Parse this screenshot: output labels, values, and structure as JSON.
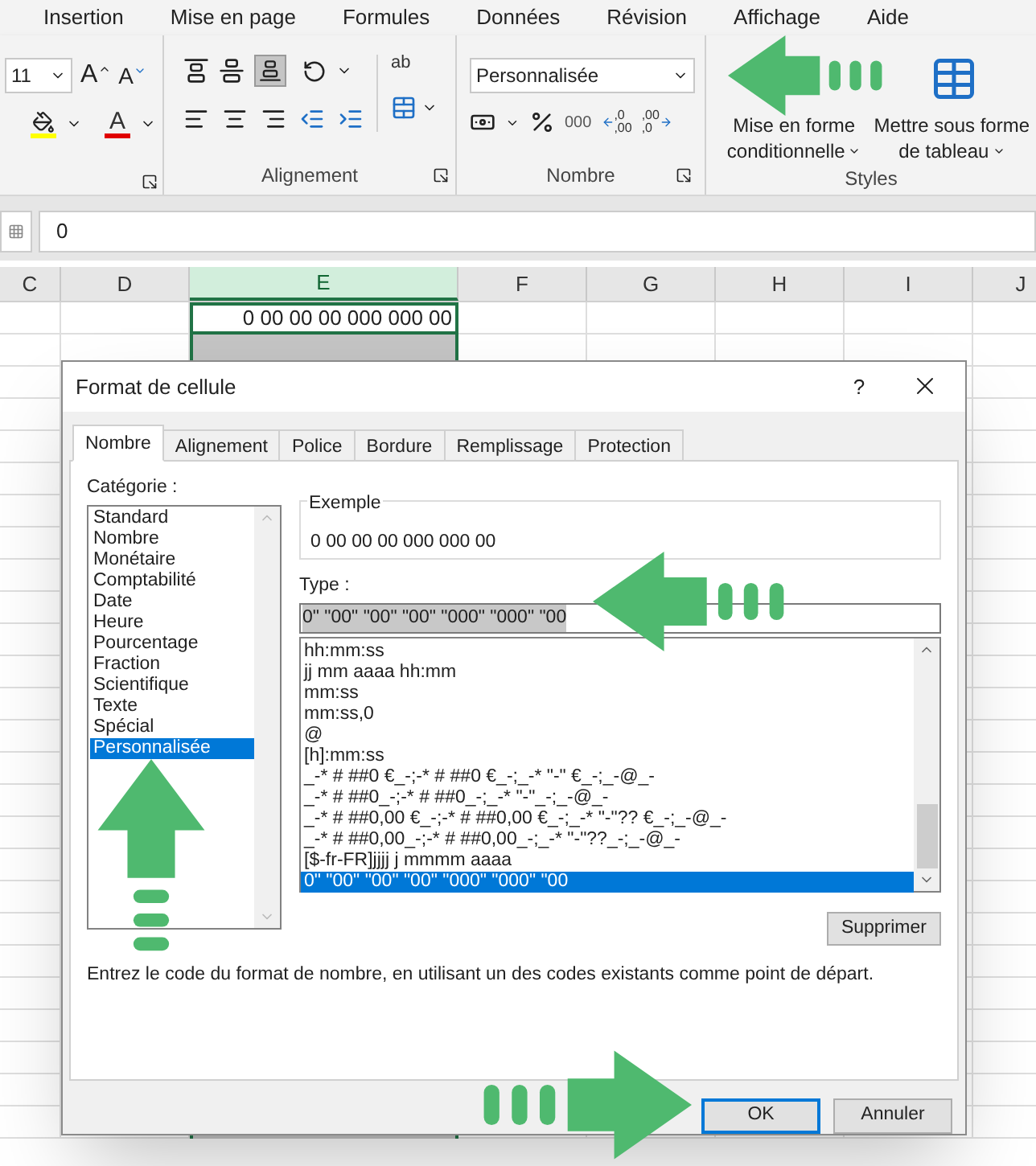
{
  "ribbon": {
    "tabs": [
      "Insertion",
      "Mise en page",
      "Formules",
      "Données",
      "Révision",
      "Affichage",
      "Aide"
    ],
    "font": {
      "size": "11",
      "grow_letter": "A",
      "shrink_letter": "A",
      "color_letter": "A"
    },
    "alignment": {
      "label": "Alignement",
      "wrap_letters": "ab"
    },
    "number": {
      "label": "Nombre",
      "format": "Personnalisée",
      "thousands": "000",
      "decimals": [
        {
          "top": ",0",
          "bottom": ",00"
        },
        {
          "top": ",00",
          "bottom": ",0"
        }
      ]
    },
    "styles": {
      "label": "Styles",
      "buttons": [
        {
          "line1": "Mise en forme",
          "line2": "conditionnelle"
        },
        {
          "line1": "Mettre sous forme",
          "line2": "de tableau"
        }
      ]
    }
  },
  "formula_bar": {
    "value": "0"
  },
  "sheet": {
    "columns": [
      {
        "label": "C",
        "selected": false
      },
      {
        "label": "D",
        "selected": false
      },
      {
        "label": "E",
        "selected": true
      },
      {
        "label": "F",
        "selected": false
      },
      {
        "label": "G",
        "selected": false
      },
      {
        "label": "H",
        "selected": false
      },
      {
        "label": "I",
        "selected": false
      },
      {
        "label": "J",
        "selected": false
      }
    ],
    "active_cell": "0 00 00 00 000 000 00"
  },
  "dialog": {
    "title": "Format de cellule",
    "help": "?",
    "tabs": [
      {
        "label": "Nombre",
        "selected": true
      },
      {
        "label": "Alignement",
        "selected": false
      },
      {
        "label": "Police",
        "selected": false
      },
      {
        "label": "Bordure",
        "selected": false
      },
      {
        "label": "Remplissage",
        "selected": false
      },
      {
        "label": "Protection",
        "selected": false
      }
    ],
    "category_label": "Catégorie :",
    "categories": [
      {
        "label": "Standard",
        "selected": false
      },
      {
        "label": "Nombre",
        "selected": false
      },
      {
        "label": "Monétaire",
        "selected": false
      },
      {
        "label": "Comptabilité",
        "selected": false
      },
      {
        "label": "Date",
        "selected": false
      },
      {
        "label": "Heure",
        "selected": false
      },
      {
        "label": "Pourcentage",
        "selected": false
      },
      {
        "label": "Fraction",
        "selected": false
      },
      {
        "label": "Scientifique",
        "selected": false
      },
      {
        "label": "Texte",
        "selected": false
      },
      {
        "label": "Spécial",
        "selected": false
      },
      {
        "label": "Personnalisée",
        "selected": true
      }
    ],
    "example": {
      "label": "Exemple",
      "value": "0 00 00 00 000 000 00"
    },
    "type_label": "Type :",
    "type_value": "0\" \"00\" \"00\" \"00\" \"000\" \"000\" \"00",
    "types": [
      {
        "label": "hh:mm:ss",
        "selected": false
      },
      {
        "label": "jj mm aaaa hh:mm",
        "selected": false
      },
      {
        "label": "mm:ss",
        "selected": false
      },
      {
        "label": "mm:ss,0",
        "selected": false
      },
      {
        "label": "@",
        "selected": false
      },
      {
        "label": "[h]:mm:ss",
        "selected": false
      },
      {
        "label": "_-* # ##0 €_-;-* # ##0 €_-;_-* \"-\" €_-;_-@_-",
        "selected": false
      },
      {
        "label": "_-* # ##0_-;-* # ##0_-;_-* \"-\"_-;_-@_-",
        "selected": false
      },
      {
        "label": "_-* # ##0,00 €_-;-* # ##0,00 €_-;_-* \"-\"?? €_-;_-@_-",
        "selected": false
      },
      {
        "label": "_-* # ##0,00_-;-* # ##0,00_-;_-* \"-\"??_-;_-@_-",
        "selected": false
      },
      {
        "label": "[$-fr-FR]jjjj j mmmm aaaa",
        "selected": false
      },
      {
        "label": "0\" \"00\" \"00\" \"00\" \"000\" \"000\" \"00",
        "selected": true
      }
    ],
    "delete_button": "Supprimer",
    "description": "Entrez le code du format de nombre, en utilisant un des codes existants comme point de départ.",
    "buttons": [
      {
        "label": "OK",
        "default": true
      },
      {
        "label": "Annuler",
        "default": false
      }
    ]
  }
}
